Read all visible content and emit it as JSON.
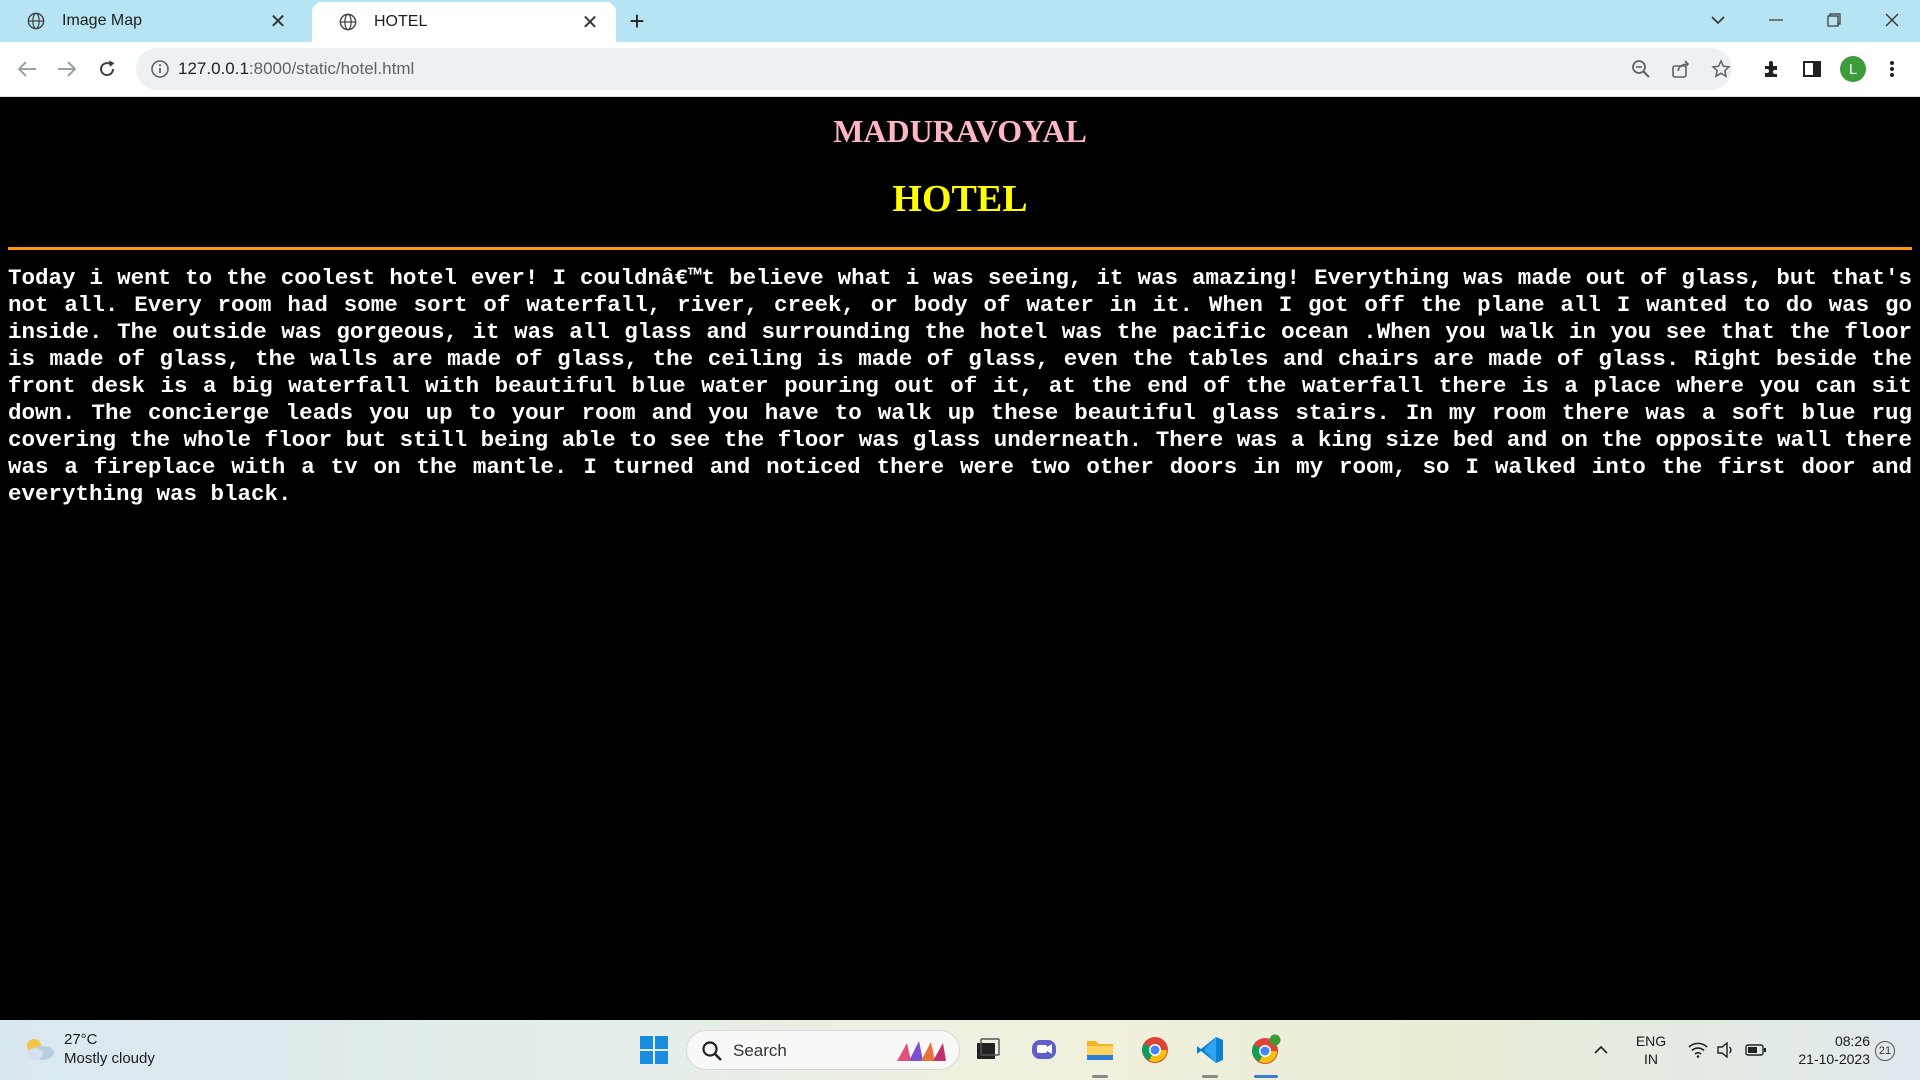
{
  "browser": {
    "tabs": [
      {
        "title": "Image Map",
        "icon": "globe-icon",
        "active": false
      },
      {
        "title": "HOTEL",
        "icon": "globe-icon",
        "active": true
      }
    ],
    "url_host": "127.0.0.1",
    "url_rest": ":8000/static/hotel.html",
    "profile_initial": "L"
  },
  "page": {
    "city_heading": "MADURAVOYAL",
    "hotel_heading": "HOTEL",
    "story": "Today i went to the coolest hotel ever! I couldnâ€™t believe what i was seeing, it was amazing! Everything was made out of glass, but that's not all. Every room had some sort of waterfall, river, creek, or body of water in it. When I got off the plane all I wanted to do was go inside. The outside was gorgeous, it was all glass and surrounding the hotel was the pacific ocean .When you walk in you see that the floor is made of glass, the walls are made of glass, the ceiling is made of glass, even the tables and chairs are made of glass. Right beside the front desk is a big waterfall with beautiful blue water pouring out of it, at the end of the waterfall there is a place where you can sit down. The concierge leads you up to your room and you have to walk up these beautiful glass stairs. In my room there was a soft blue rug covering the whole floor but still being able to see the floor was glass underneath. There was a king size bed and on the opposite wall there was a fireplace with a tv on the mantle. I turned and noticed there were two other doors in my room, so I walked into the first door and everything was black.",
    "colors": {
      "background": "#000000",
      "city_heading": "#ffb6c1",
      "hotel_heading": "#ffff00",
      "rule": "#ff9900",
      "text": "#ffffff"
    }
  },
  "taskbar": {
    "temperature": "27°C",
    "weather": "Mostly cloudy",
    "search_placeholder": "Search",
    "language": "ENG",
    "region": "IN",
    "time": "08:26",
    "date": "21-10-2023",
    "notifications": "21"
  }
}
